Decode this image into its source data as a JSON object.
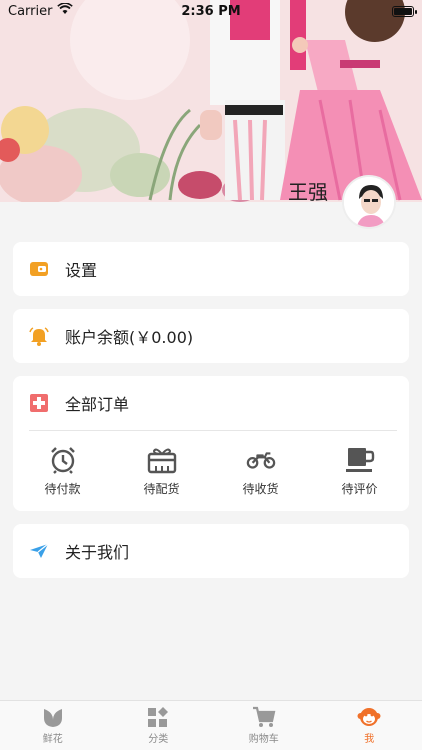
{
  "status_bar": {
    "carrier": "Carrier",
    "time": "2:36 PM"
  },
  "profile": {
    "name": "王强"
  },
  "menu": {
    "settings": {
      "label": "设置",
      "icon": "wallet-icon"
    },
    "balance": {
      "label": "账户余额(￥0.00)",
      "icon": "bell-icon"
    },
    "orders": {
      "label": "全部订单",
      "icon": "cross-box-icon",
      "items": [
        {
          "label": "待付款",
          "icon": "alarm-clock-icon"
        },
        {
          "label": "待配货",
          "icon": "gift-icon"
        },
        {
          "label": "待收货",
          "icon": "motorbike-icon"
        },
        {
          "label": "待评价",
          "icon": "cup-icon"
        }
      ]
    },
    "about": {
      "label": "关于我们",
      "icon": "send-icon"
    }
  },
  "tabbar": {
    "items": [
      {
        "label": "鲜花",
        "icon": "leaf-icon"
      },
      {
        "label": "分类",
        "icon": "category-icon"
      },
      {
        "label": "购物车",
        "icon": "cart-icon"
      },
      {
        "label": "我",
        "icon": "monkey-face-icon"
      }
    ],
    "active_index": 3
  },
  "colors": {
    "accent": "#f0712a",
    "settings_icon": "#f2a023",
    "balance_icon": "#f2a023",
    "orders_icon": "#f06d6d",
    "about_icon": "#3aa0e8",
    "icon_gray": "#555555"
  }
}
